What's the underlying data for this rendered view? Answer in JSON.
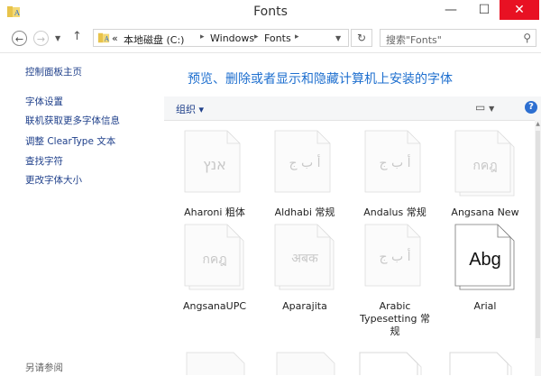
{
  "window": {
    "title": "Fonts",
    "minimize_glyph": "—",
    "maximize_glyph": "☐",
    "close_glyph": "✕"
  },
  "nav": {
    "back_icon": "back-arrow-icon",
    "forward_icon": "forward-arrow-icon",
    "recent_icon": "chevron-down-icon",
    "up_icon": "up-arrow-icon",
    "breadcrumb": {
      "overflow": "«",
      "items": [
        "本地磁盘 (C:)",
        "Windows",
        "Fonts"
      ]
    },
    "search_placeholder": "搜索\"Fonts\""
  },
  "sidebar": {
    "home": "控制面板主页",
    "links": [
      "字体设置",
      "联机获取更多字体信息",
      "调整 ClearType 文本",
      "查找字符",
      "更改字体大小"
    ],
    "see_also": "另请参阅"
  },
  "main": {
    "heading": "预览、删除或者显示和隐藏计算机上安装的字体",
    "toolbar": {
      "organize": "组织 ▾",
      "help": "?"
    }
  },
  "fonts": [
    {
      "name": "Aharoni 粗体",
      "sample": "אנץ",
      "stacked": false,
      "enabled": false
    },
    {
      "name": "Aldhabi 常规",
      "sample": "أ ب ج",
      "stacked": false,
      "enabled": false
    },
    {
      "name": "Andalus 常规",
      "sample": "أ ب ج",
      "stacked": false,
      "enabled": false
    },
    {
      "name": "Angsana New",
      "sample": "กคฎ",
      "stacked": true,
      "enabled": false
    },
    {
      "name": "AngsanaUPC",
      "sample": "กคฎ",
      "stacked": true,
      "enabled": false
    },
    {
      "name": "Aparajita",
      "sample": "अबक",
      "stacked": true,
      "enabled": false
    },
    {
      "name": "Arabic Typesetting 常规",
      "sample": "أ ب ج",
      "stacked": false,
      "enabled": false
    },
    {
      "name": "Arial",
      "sample": "Abg",
      "stacked": true,
      "enabled": true
    }
  ]
}
